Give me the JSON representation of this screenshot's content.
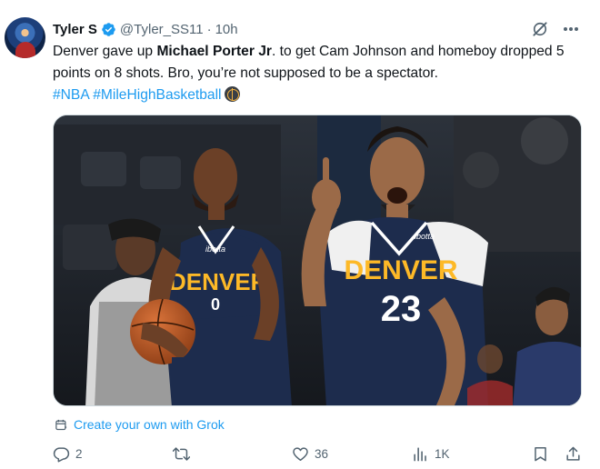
{
  "author": {
    "name": "Tyler S",
    "handle": "@Tyler_SS11",
    "separator": "·",
    "time": "10h"
  },
  "tweet": {
    "text_part1": "Denver gave up ",
    "bold_name": "Michael Porter Jr",
    "text_part2": ". to get Cam Johnson and homeboy dropped 5 points on 8 shots. Bro, you’re not supposed to be a spectator.",
    "hashtag1": "#NBA",
    "hashtag2": "#MileHighBasketball"
  },
  "media": {
    "jersey_left_text": "DENVER",
    "jersey_right_text": "DENVER",
    "jersey_right_number": "23",
    "jersey_brand": "ibotta"
  },
  "grok": {
    "label": "Create your own with Grok"
  },
  "actions": {
    "replies": "2",
    "reposts": "",
    "likes": "36",
    "views": "1K"
  },
  "colors": {
    "accent": "#1d9bf0",
    "muted": "#536471",
    "text": "#0f1419",
    "nuggets_navy": "#1d2c4d",
    "nuggets_gold": "#fdb927"
  },
  "icons": {
    "verified": "verified-badge-icon",
    "grok": "grok-icon",
    "more": "more-icon",
    "reply": "reply-icon",
    "repost": "repost-icon",
    "like": "like-icon",
    "views": "views-icon",
    "bookmark": "bookmark-icon",
    "share": "share-icon"
  }
}
